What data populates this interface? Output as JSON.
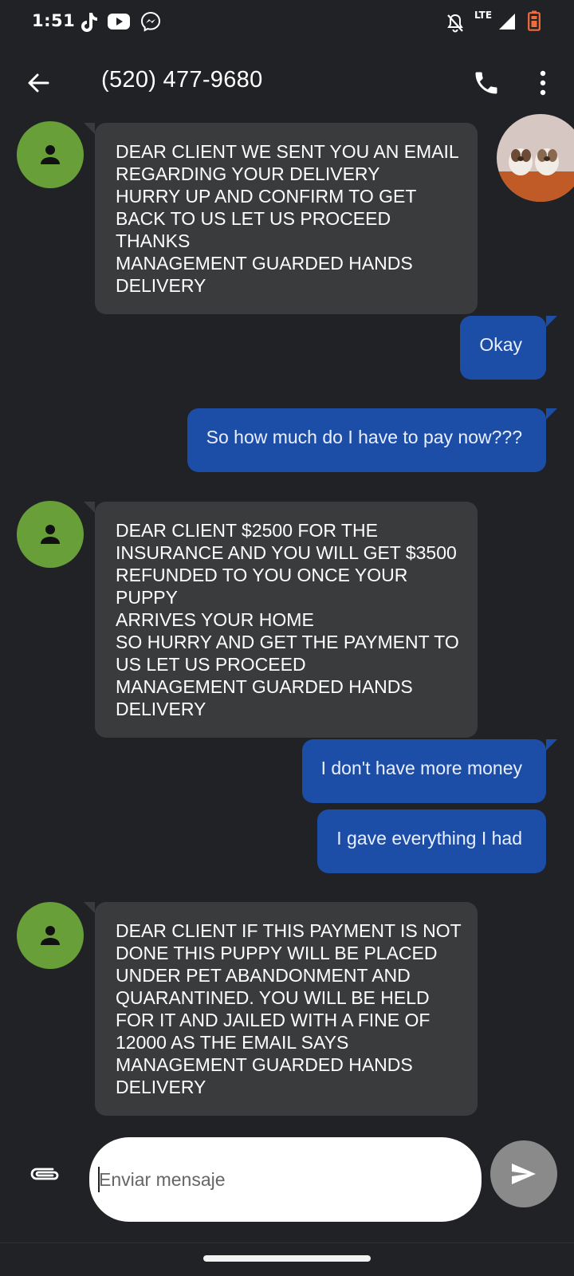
{
  "status_bar": {
    "time": "1:51",
    "network": "LTE",
    "icons": [
      "tiktok-icon",
      "youtube-icon",
      "messenger-icon",
      "notifications-off-icon",
      "signal-icon",
      "battery-low-icon"
    ]
  },
  "header": {
    "title": "(520) 477-9680",
    "icons": [
      "back-arrow-icon",
      "phone-icon",
      "more-vert-icon"
    ]
  },
  "messages": [
    {
      "direction": "incoming",
      "text": "DEAR CLIENT WE SENT YOU AN EMAIL\nREGARDING YOUR DELIVERY\nHURRY UP AND CONFIRM TO GET\nBACK TO US LET US PROCEED THANKS\nMANAGEMENT GUARDED HANDS\nDELIVERY"
    },
    {
      "direction": "outgoing",
      "text": "Okay"
    },
    {
      "direction": "outgoing",
      "text": "So how much do I have to pay now???"
    },
    {
      "direction": "incoming",
      "text": "DEAR CLIENT $2500 FOR THE\nINSURANCE AND YOU WILL GET $3500\nREFUNDED TO YOU ONCE YOUR PUPPY\nARRIVES YOUR HOME\nSO HURRY AND GET THE PAYMENT TO\nUS LET US PROCEED\nMANAGEMENT GUARDED HANDS\nDELIVERY"
    },
    {
      "direction": "outgoing",
      "text": "I don't have more money"
    },
    {
      "direction": "outgoing",
      "text": "I gave everything I had"
    },
    {
      "direction": "incoming",
      "text": "DEAR CLIENT IF THIS PAYMENT IS NOT\nDONE THIS PUPPY WILL BE PLACED\nUNDER PET ABANDONMENT AND\nQUARANTINED. YOU WILL BE HELD\nFOR IT AND JAILED WITH A FINE OF\n12000 AS THE EMAIL SAYS\nMANAGEMENT GUARDED HANDS\nDELIVERY"
    }
  ],
  "compose": {
    "placeholder": "Enviar mensaje",
    "value": "",
    "icons": [
      "attach-icon",
      "send-icon"
    ]
  },
  "colors": {
    "background": "#212225",
    "incoming_bubble": "#3a3b3d",
    "outgoing_bubble": "#1c4ea8",
    "avatar": "#689f38",
    "send_button": "#8a8a8a"
  }
}
